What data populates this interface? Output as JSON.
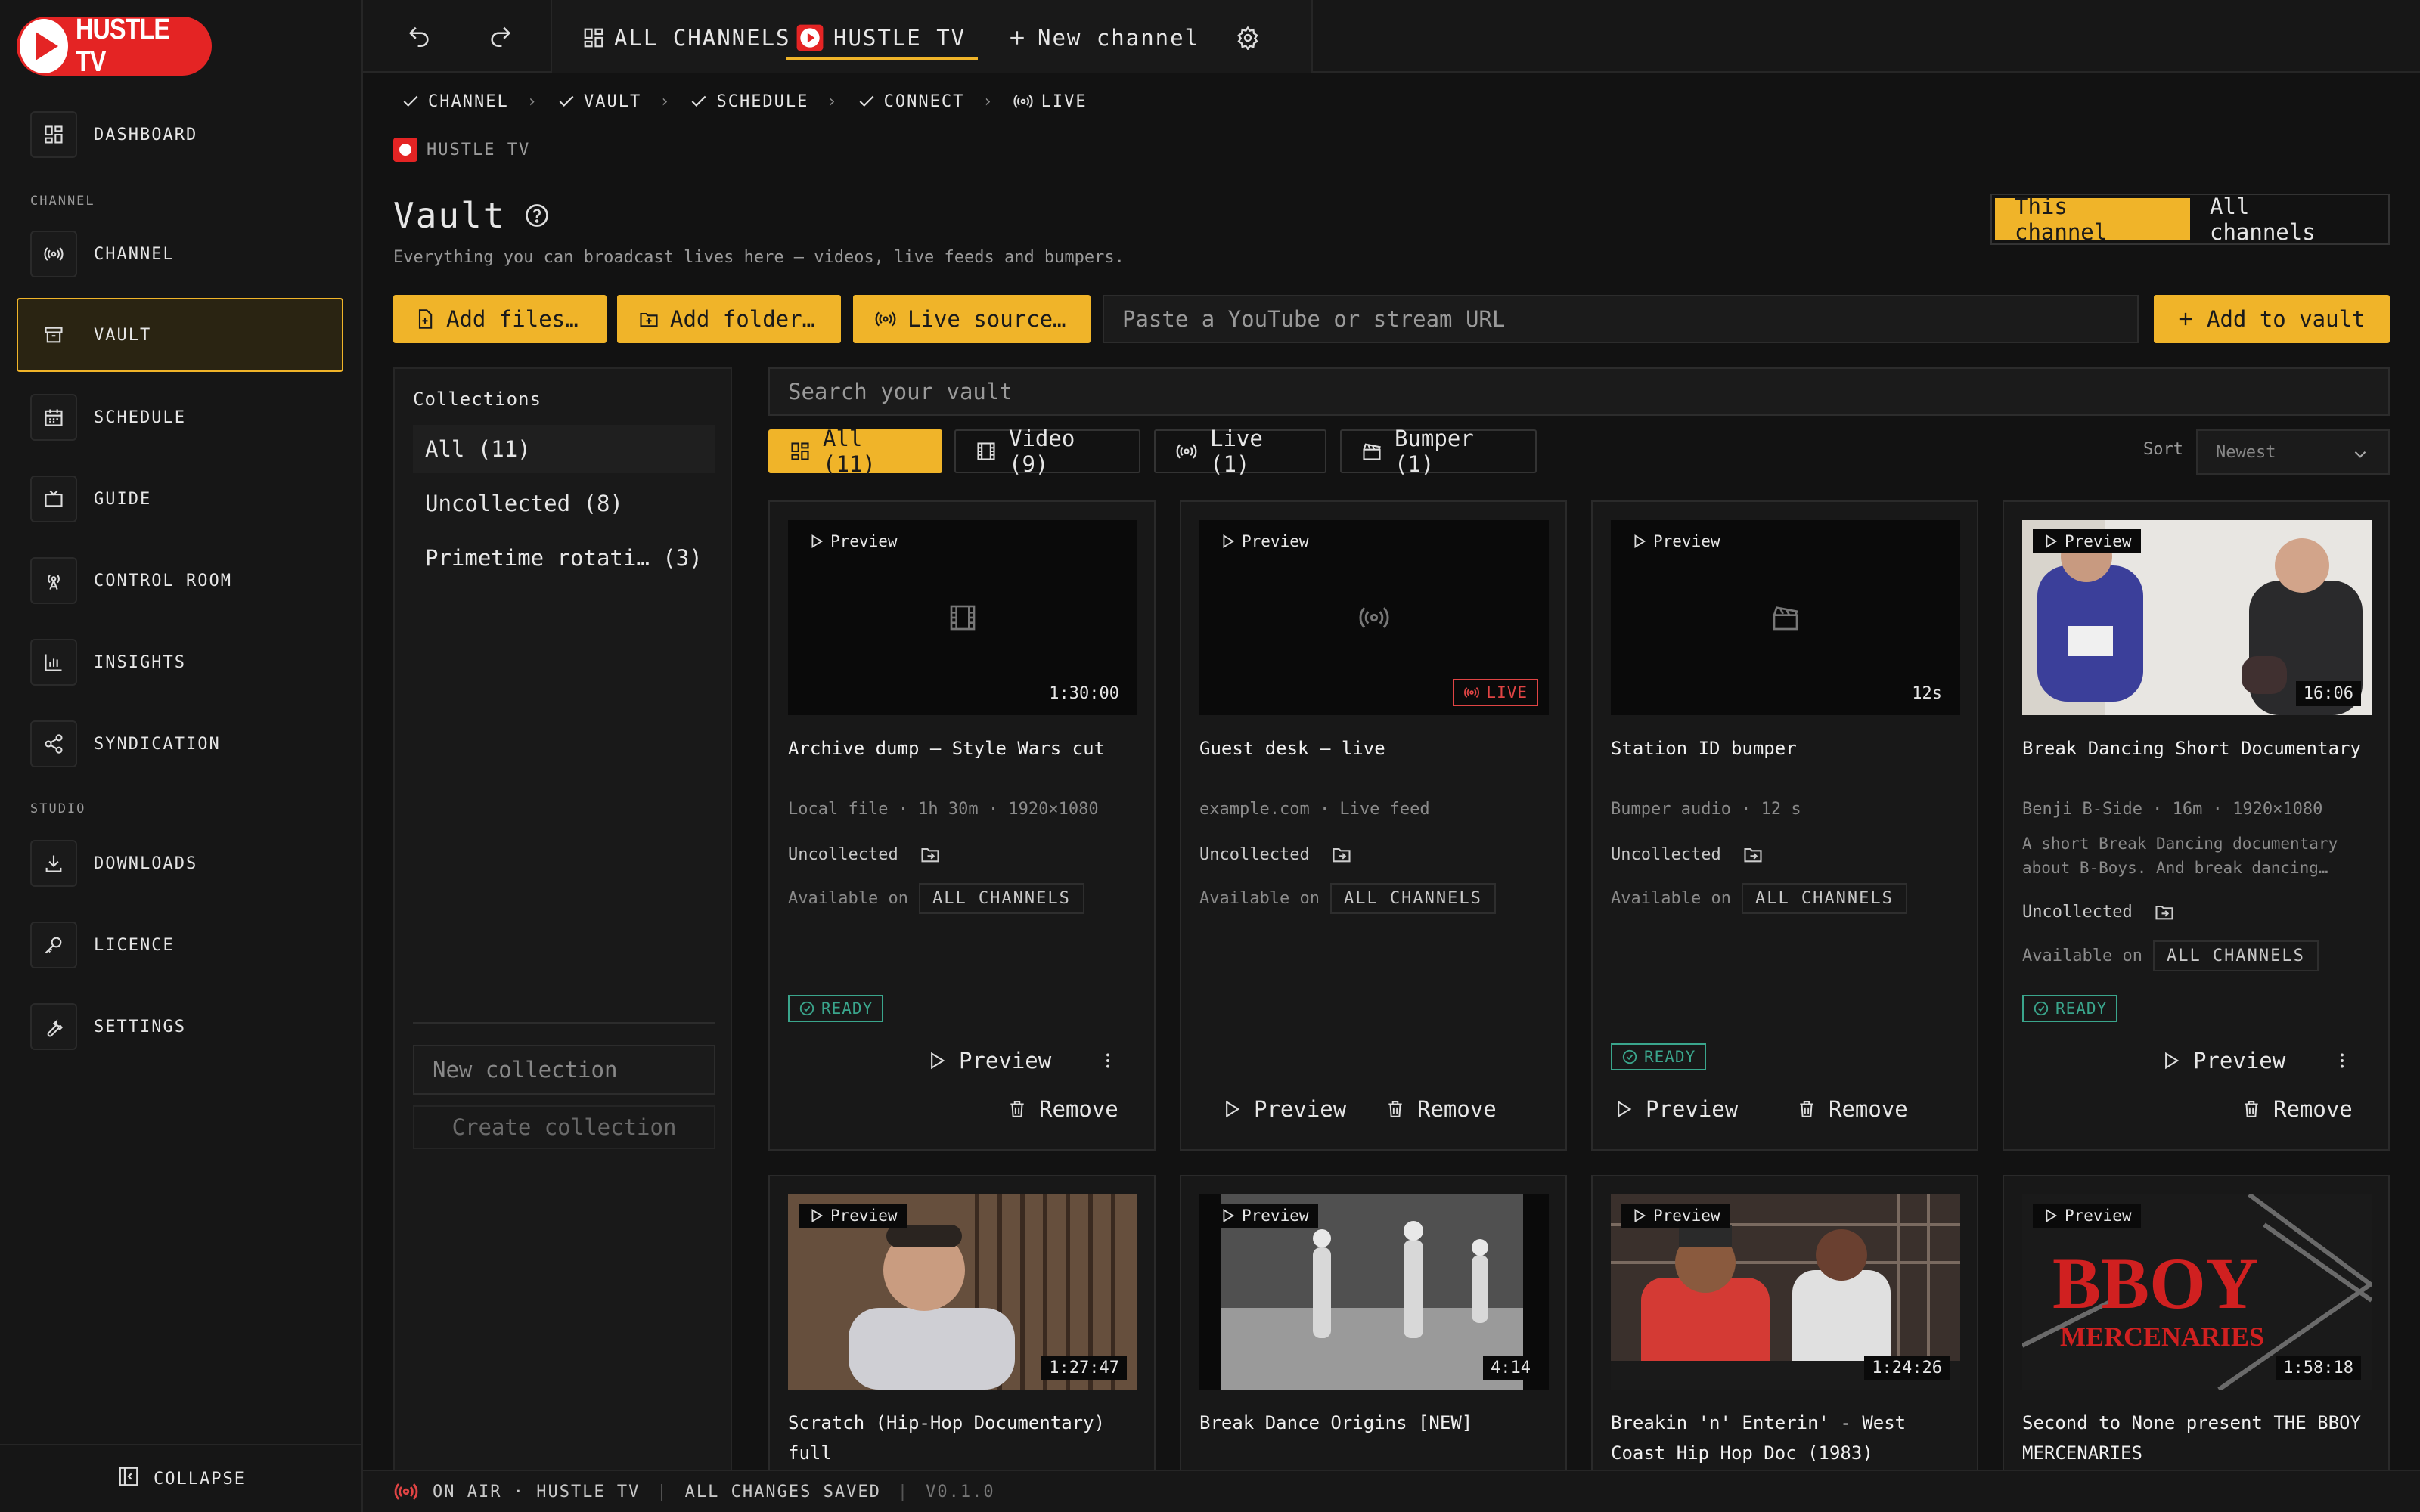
{
  "app": {
    "logo_text": "HUSTLE TV",
    "accent": "#f0b429",
    "brand": "#e42424"
  },
  "sidebar": {
    "dashboard": "DASHBOARD",
    "section_channel": "CHANNEL",
    "channel": "CHANNEL",
    "vault": "VAULT",
    "schedule": "SCHEDULE",
    "guide": "GUIDE",
    "control_room": "CONTROL ROOM",
    "insights": "INSIGHTS",
    "syndication": "SYNDICATION",
    "section_studio": "STUDIO",
    "downloads": "DOWNLOADS",
    "licence": "LICENCE",
    "settings": "SETTINGS",
    "collapse": "COLLAPSE"
  },
  "topbar": {
    "all_channels": "ALL CHANNELS",
    "current_channel": "HUSTLE TV",
    "new_channel": "New channel"
  },
  "breadcrumb": [
    "CHANNEL",
    "VAULT",
    "SCHEDULE",
    "CONNECT",
    "LIVE"
  ],
  "channel_label": "HUSTLE TV",
  "page": {
    "title": "Vault",
    "subtitle": "Everything you can broadcast lives here — videos, live feeds and bumpers.",
    "scope_this": "This channel",
    "scope_all": "All channels"
  },
  "actions": {
    "add_files": "Add files…",
    "add_folder": "Add folder…",
    "live_source": "Live source…",
    "url_placeholder": "Paste a YouTube or stream URL",
    "add_to_vault": "Add to vault"
  },
  "collections": {
    "heading": "Collections",
    "items": [
      "All (11)",
      "Uncollected (8)",
      "Primetime rotati… (3)"
    ],
    "new_placeholder": "New collection",
    "create": "Create collection"
  },
  "search": {
    "placeholder": "Search your vault"
  },
  "filters": [
    "All (11)",
    "Video (9)",
    "Live (1)",
    "Bumper (1)"
  ],
  "sort": {
    "label": "Sort",
    "value": "Newest"
  },
  "labels": {
    "preview_badge": "Preview",
    "live_badge": "LIVE",
    "uncollected": "Uncollected",
    "available_on": "Available on",
    "all_channels_chip": "ALL CHANNELS",
    "ready": "READY",
    "preview": "Preview",
    "remove": "Remove"
  },
  "cards": [
    {
      "title": "Archive dump — Style Wars cut",
      "duration": "1:30:00",
      "meta": "Local file · 1h 30m · 1920×1080"
    },
    {
      "title": "Guest desk — live",
      "meta": "example.com · Live feed"
    },
    {
      "title": "Station ID bumper",
      "duration": "12s",
      "meta": "Bumper audio · 12 s"
    },
    {
      "title": "Break Dancing Short Documentary",
      "duration": "16:06",
      "meta": "Benji B-Side · 16m · 1920×1080",
      "description": "A short Break Dancing documentary about B-Boys. And break dancing…"
    },
    {
      "title": "Scratch (Hip-Hop Documentary) full",
      "duration": "1:27:47"
    },
    {
      "title": "Break Dance Origins [NEW]",
      "duration": "4:14"
    },
    {
      "title": "Breakin 'n' Enterin' - West Coast Hip Hop Doc (1983)",
      "duration": "1:24:26"
    },
    {
      "title": "Second to None present THE BBOY MERCENARIES",
      "duration": "1:58:18",
      "thumb_text_1": "BBOY",
      "thumb_text_2": "MERCENARIES"
    }
  ],
  "status": {
    "on_air": "ON AIR · HUSTLE TV",
    "saved": "ALL CHANGES SAVED",
    "version": "V0.1.0"
  }
}
